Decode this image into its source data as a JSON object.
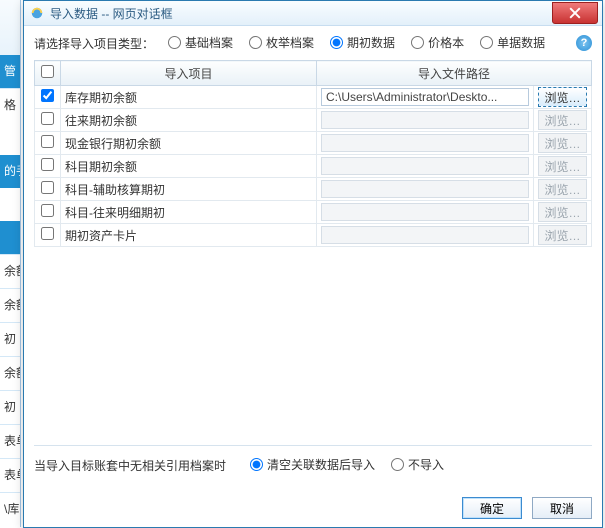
{
  "window": {
    "title": "导入数据 -- 网页对话框",
    "close_tooltip": "Close"
  },
  "type_row": {
    "label": "请选择导入项目类型：",
    "options": [
      {
        "value": "basic",
        "label": "基础档案",
        "checked": false
      },
      {
        "value": "enum",
        "label": "枚举档案",
        "checked": false
      },
      {
        "value": "open",
        "label": "期初数据",
        "checked": true
      },
      {
        "value": "price",
        "label": "价格本",
        "checked": false
      },
      {
        "value": "bill",
        "label": "单据数据",
        "checked": false
      }
    ],
    "help": "?"
  },
  "table": {
    "headers": {
      "checkbox": "",
      "project": "导入项目",
      "path": "导入文件路径",
      "browse": ""
    },
    "browse_label": "浏览…",
    "rows": [
      {
        "id": "inv-open",
        "label": "库存期初余额",
        "checked": true,
        "path": "C:\\Users\\Administrator\\Deskto...",
        "enabled": true
      },
      {
        "id": "ar-open",
        "label": "往来期初余额",
        "checked": false,
        "path": "",
        "enabled": false
      },
      {
        "id": "cash-open",
        "label": "现金银行期初余额",
        "checked": false,
        "path": "",
        "enabled": false
      },
      {
        "id": "acct-open",
        "label": "科目期初余额",
        "checked": false,
        "path": "",
        "enabled": false
      },
      {
        "id": "acct-aux-open",
        "label": "科目-辅助核算期初",
        "checked": false,
        "path": "",
        "enabled": false
      },
      {
        "id": "acct-detail-open",
        "label": "科目-往来明细期初",
        "checked": false,
        "path": "",
        "enabled": false
      },
      {
        "id": "asset-open",
        "label": "期初资产卡片",
        "checked": false,
        "path": "",
        "enabled": false
      }
    ]
  },
  "footer_opt": {
    "label": "当导入目标账套中无相关引用档案时",
    "options": [
      {
        "value": "clear",
        "label": "清空关联数据后导入",
        "checked": true
      },
      {
        "value": "skip",
        "label": "不导入",
        "checked": false
      }
    ]
  },
  "buttons": {
    "ok": "确定",
    "cancel": "取消"
  },
  "sidebar": {
    "items": [
      {
        "text": "管",
        "style": "block"
      },
      {
        "text": "格",
        "style": "div"
      },
      {
        "text": "",
        "style": ""
      },
      {
        "text": "的手",
        "style": "block"
      },
      {
        "text": "",
        "style": ""
      },
      {
        "text": "",
        "style": "block"
      },
      {
        "text": "余额",
        "style": "div"
      },
      {
        "text": "余额",
        "style": "div"
      },
      {
        "text": "初",
        "style": "div"
      },
      {
        "text": "余额",
        "style": "div"
      },
      {
        "text": "初",
        "style": "div"
      },
      {
        "text": "表单",
        "style": "div"
      },
      {
        "text": "表单",
        "style": "div"
      },
      {
        "text": "\\库",
        "style": "div"
      }
    ]
  }
}
